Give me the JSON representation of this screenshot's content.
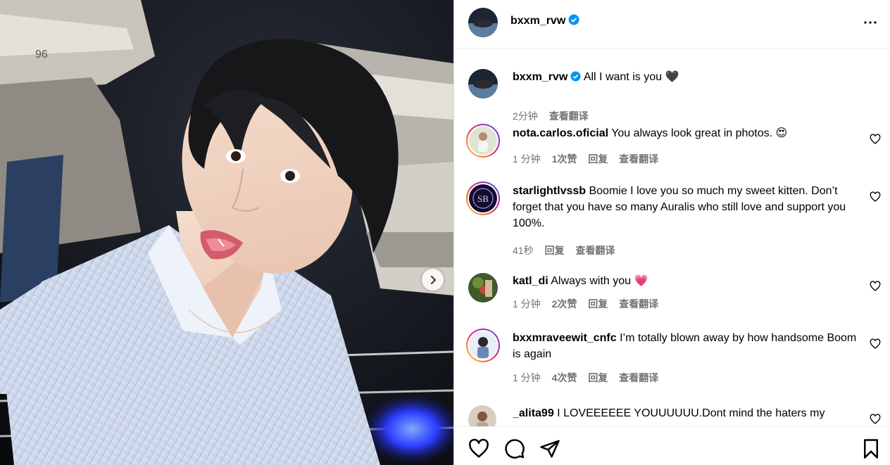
{
  "post": {
    "author": "bxxm_rvw",
    "verified": true,
    "caption": "All I want is you",
    "caption_emoji": "🖤",
    "caption_time": "2分钟",
    "caption_translate": "查看翻译"
  },
  "comments": [
    {
      "username": "nota.carlos.oficial",
      "text": "You always look great in photos.",
      "emoji": "😍",
      "time": "1 分钟",
      "likes": "1次赞",
      "reply": "回复",
      "translate": "查看翻译"
    },
    {
      "username": "starlightlvssb",
      "text": "Boomie I love you so much my sweet kitten. Don’t forget that you have so many Auralis who still love and support you 100%.",
      "time": "41秒",
      "reply": "回复",
      "translate": "查看翻译",
      "avatar_initials": "SB"
    },
    {
      "username": "katl_di",
      "text": "Always with you",
      "emoji": "💗",
      "time": "1 分钟",
      "likes": "2次赞",
      "reply": "回复",
      "translate": "查看翻译"
    },
    {
      "username": "bxxmraveewit_cnfc",
      "text": "I’m totally blown away by how handsome Boom is again",
      "time": "1 分钟",
      "likes": "4次赞",
      "reply": "回复",
      "translate": "查看翻译"
    },
    {
      "username": "_alita99",
      "text": "I LOVEEEEEE YOUUUUUU.Dont mind the haters my"
    }
  ],
  "photo": {
    "boat_number": "96"
  },
  "colors": {
    "verified": "#0095f6",
    "meta": "#737373",
    "border": "#dbdbdb"
  },
  "icons": [
    "more-icon",
    "heart-icon",
    "comment-icon",
    "share-icon",
    "bookmark-icon",
    "chevron-right-icon",
    "verified-icon"
  ]
}
